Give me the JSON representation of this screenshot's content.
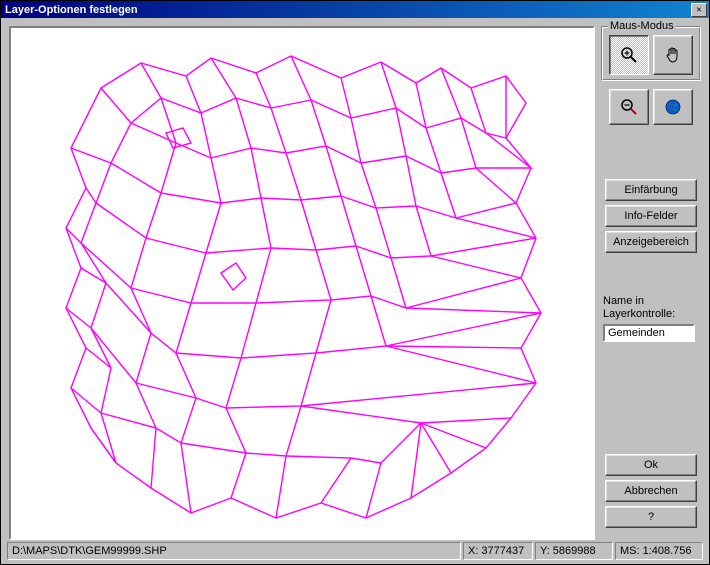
{
  "title": "Layer-Optionen festlegen",
  "mouse_mode": {
    "label": "Maus-Modus",
    "zoom_in_active": true
  },
  "buttons": {
    "coloring": "Einfärbung",
    "info_fields": "Info-Felder",
    "display_area": "Anzeigebereich",
    "ok": "Ok",
    "cancel": "Abbrechen",
    "help": "?"
  },
  "layer_name": {
    "label_line1": "Name in",
    "label_line2": "Layerkontrolle:",
    "value": "Gemeinden"
  },
  "status": {
    "path": "D:\\MAPS\\DTK\\GEM99999.SHP",
    "x_label": "X:",
    "x": "3777437",
    "y_label": "Y:",
    "y": "5869988",
    "ms_label": "MS:",
    "ms": "1:408.756"
  }
}
